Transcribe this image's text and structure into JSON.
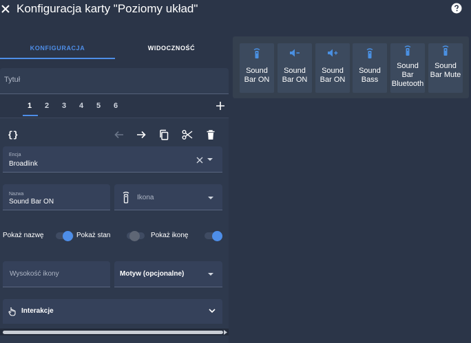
{
  "header": {
    "title": "Konfiguracja karty \"Poziomy układ\""
  },
  "tabs": {
    "config": "KONFIGURACJA",
    "visibility": "WIDOCZNOŚĆ"
  },
  "title_field": {
    "placeholder": "Tytuł"
  },
  "number_tabs": [
    "1",
    "2",
    "3",
    "4",
    "5",
    "6"
  ],
  "entity": {
    "label": "Encja",
    "value": "Broadlink"
  },
  "name_field": {
    "label": "Nazwa",
    "value": "Sound Bar ON"
  },
  "icon_field": {
    "label": "Ikona",
    "icon": "remote-icon"
  },
  "toggles": {
    "show_name": "Pokaż nazwę",
    "show_state": "Pokaż stan",
    "show_icon": "Pokaż ikonę"
  },
  "icon_height": {
    "placeholder": "Wysokość ikony"
  },
  "theme": {
    "label": "Motyw (opcjonalne)"
  },
  "interactions": {
    "label": "Interakcje"
  },
  "preview": {
    "buttons": [
      {
        "label": "Sound Bar ON",
        "icon": "remote-icon"
      },
      {
        "label": "Sound Bar ON",
        "icon": "volume-minus-icon"
      },
      {
        "label": "Sound Bar ON",
        "icon": "volume-plus-icon"
      },
      {
        "label": "Sound Bass",
        "icon": "remote-icon"
      },
      {
        "label": "Sound Bar Bluetooth",
        "icon": "remote-icon"
      },
      {
        "label": "Sound Bar Mute",
        "icon": "remote-icon"
      }
    ]
  },
  "colors": {
    "background": "#2b3548",
    "accent": "#4e8ee8",
    "icon_blue": "#4a90e2"
  }
}
